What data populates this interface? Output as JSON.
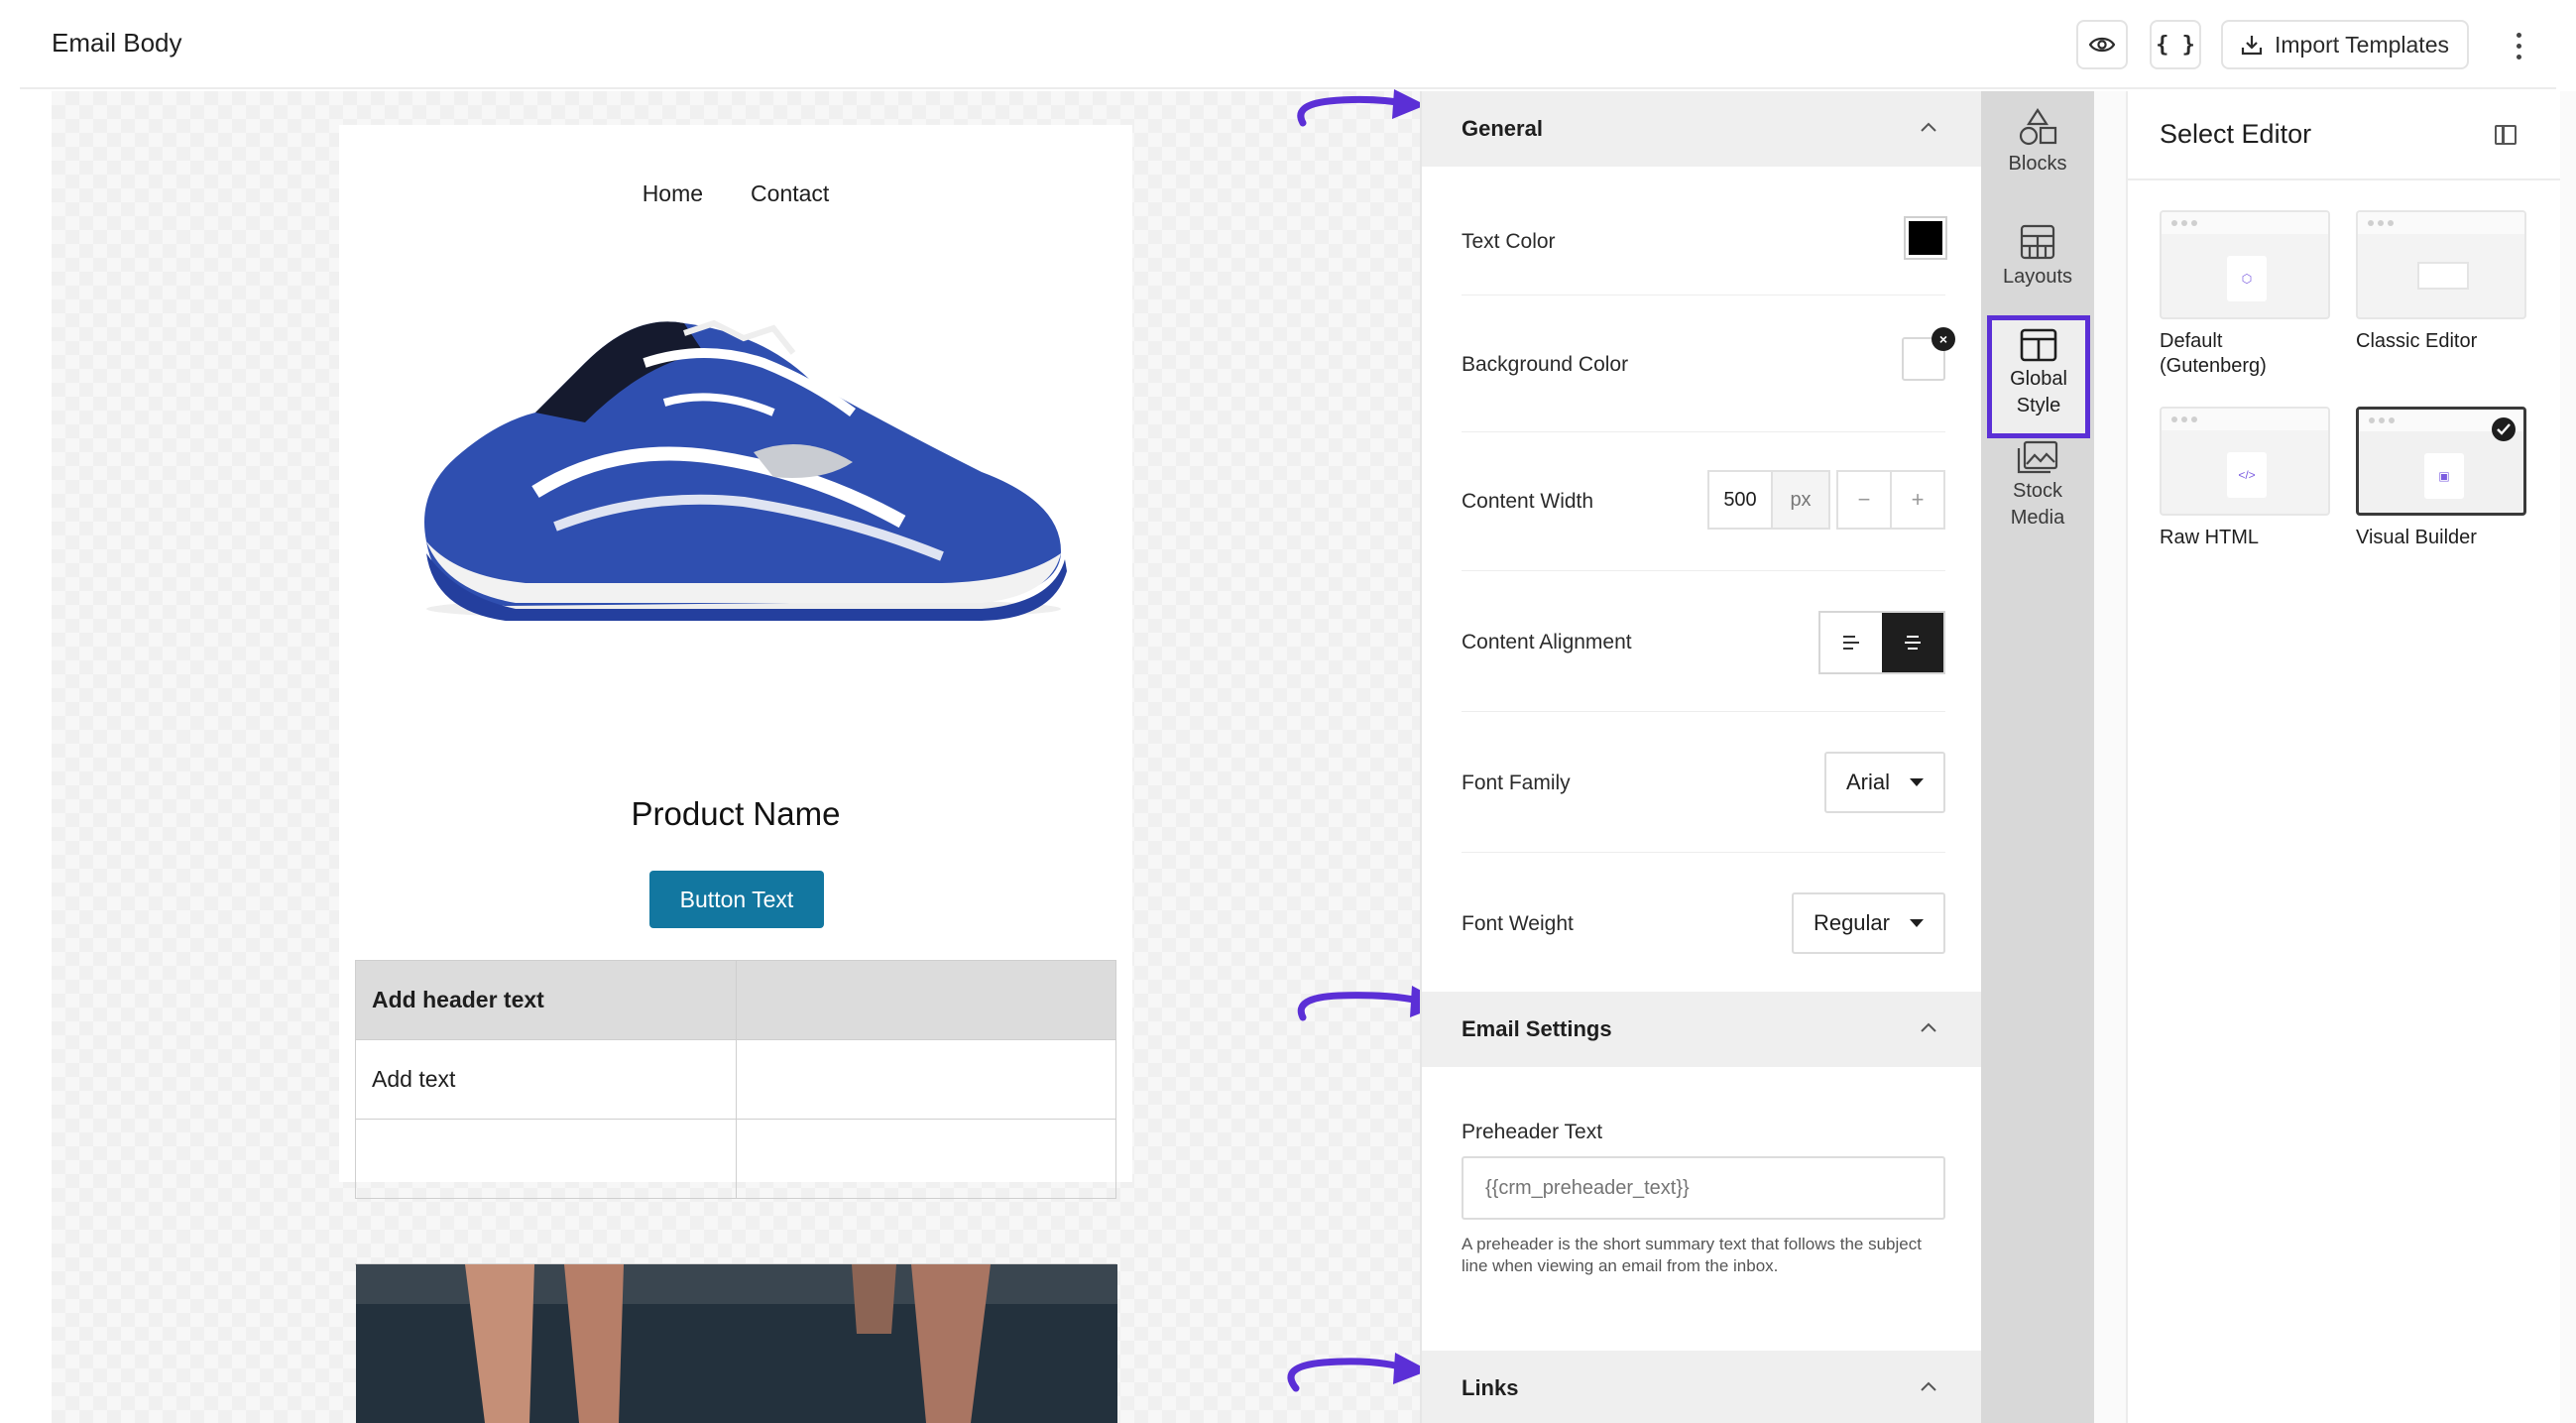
{
  "header": {
    "title": "Email Body",
    "import_label": "Import Templates",
    "code_label": "{ }"
  },
  "email": {
    "nav": [
      "Home",
      "Contact"
    ],
    "product_name": "Product Name",
    "button_text": "Button Text",
    "table": {
      "header": [
        "Add header text",
        ""
      ],
      "rows": [
        [
          "Add text",
          ""
        ],
        [
          "",
          ""
        ]
      ]
    }
  },
  "settings": {
    "general": {
      "title": "General",
      "text_color_label": "Text Color",
      "text_color": "#000000",
      "background_color_label": "Background Color",
      "content_width_label": "Content Width",
      "content_width_value": "500",
      "content_width_unit": "px",
      "minus": "−",
      "plus": "+",
      "content_alignment_label": "Content Alignment",
      "font_family_label": "Font Family",
      "font_family_value": "Arial",
      "font_weight_label": "Font Weight",
      "font_weight_value": "Regular"
    },
    "email_settings": {
      "title": "Email Settings",
      "preheader_label": "Preheader Text",
      "preheader_placeholder": "{{crm_preheader_text}}",
      "preheader_help": "A preheader is the short summary text that follows the subject line when viewing an email from the inbox."
    },
    "links": {
      "title": "Links"
    }
  },
  "rail": {
    "blocks": "Blocks",
    "layouts": "Layouts",
    "global_style_1": "Global",
    "global_style_2": "Style",
    "stock_media_1": "Stock",
    "stock_media_2": "Media"
  },
  "selector": {
    "title": "Select Editor",
    "editors": [
      {
        "label_1": "Default",
        "label_2": "(Gutenberg)"
      },
      {
        "label_1": "Classic Editor",
        "label_2": ""
      },
      {
        "label_1": "Raw HTML",
        "label_2": ""
      },
      {
        "label_1": "Visual Builder",
        "label_2": ""
      }
    ]
  },
  "colors": {
    "accent": "#5b2fd6",
    "email_button": "#1277a0"
  }
}
